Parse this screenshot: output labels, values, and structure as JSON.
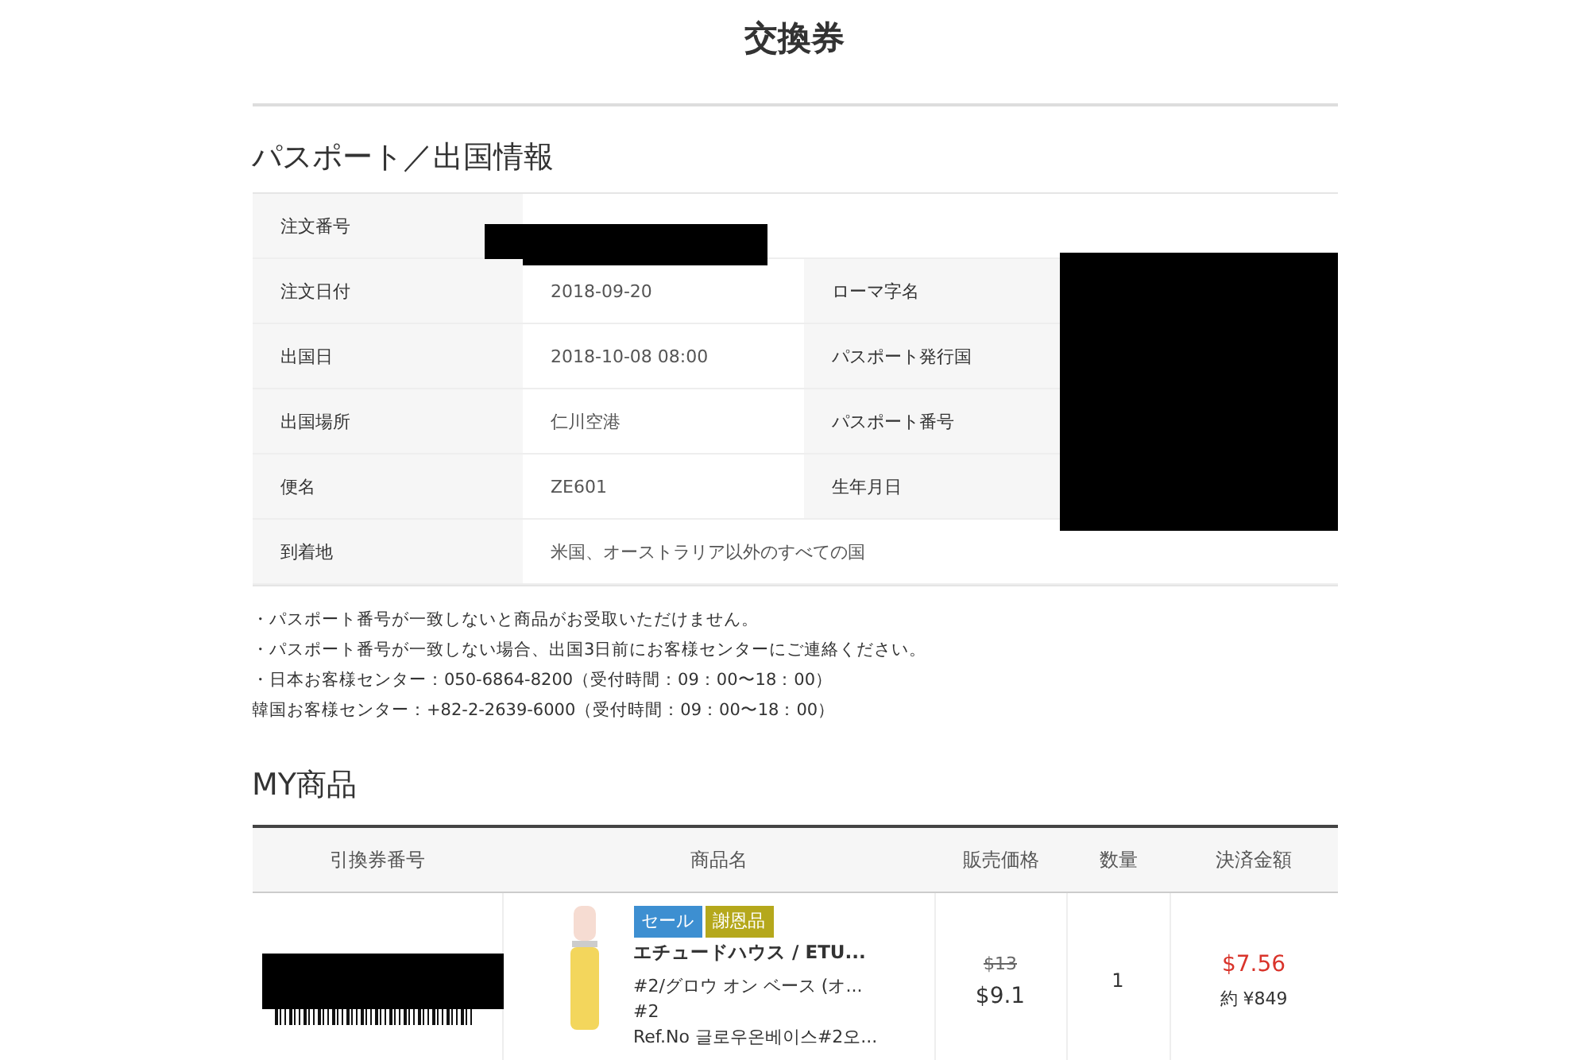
{
  "title": "交換券",
  "passport_section": {
    "heading": "パスポート／出国情報",
    "rows": [
      {
        "kind": "wide",
        "label": "注文番号"
      },
      {
        "kind": "pair",
        "label": "注文日付",
        "value": "2018-09-20",
        "label_2": "ローマ字名"
      },
      {
        "kind": "pair",
        "label": "出国日",
        "value": "2018-10-08 08:00",
        "label_2": "パスポート発行国"
      },
      {
        "kind": "pair",
        "label": "出国場所",
        "value": "仁川空港",
        "label_2": "パスポート番号"
      },
      {
        "kind": "pair",
        "label": "便名",
        "value": "ZE601",
        "label_2": "生年月日"
      },
      {
        "kind": "wide",
        "label": "到着地",
        "value": "米国、オーストラリア以外のすべての国"
      }
    ]
  },
  "notes": [
    "・パスポート番号が一致しないと商品がお受取いただけません。",
    "・パスポート番号が一致しない場合、出国3日前にお客様センターにご連絡ください。",
    "・日本お客様センター：050-6864-8200（受付時間：09：00〜18：00）",
    "韓国お客様センター：+82-2-2639-6000（受付時間：09：00〜18：00）"
  ],
  "products_section": {
    "heading": "MY商品",
    "columns": [
      "引換券番号",
      "商品名",
      "販売価格",
      "数量",
      "決済金額"
    ],
    "rows": [
      {
        "tags": [
          {
            "label": "セール",
            "color": "#3d8fd1"
          },
          {
            "label": "謝恩品",
            "color": "#b5a81c"
          }
        ],
        "brand": "エチュードハウス / ETU...",
        "name": "#2/グロウ オン ベース (オ...",
        "option": "#2",
        "ref": "Ref.No 글로우온베이스#2오...",
        "original_price": "$13",
        "price": "$9.1",
        "quantity": "1",
        "paid": "$7.56",
        "paid_yen": "約 ¥849"
      }
    ]
  }
}
